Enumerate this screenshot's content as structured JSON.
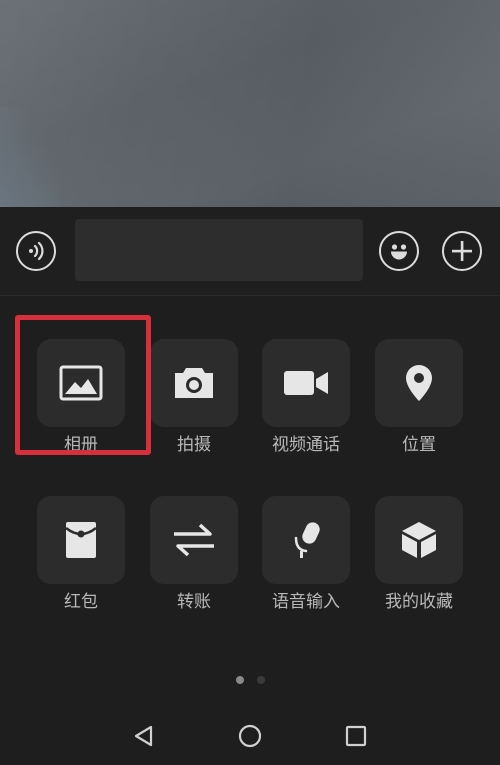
{
  "input_bar": {
    "voice_icon": "voice-wave-icon",
    "text_value": "",
    "emoji_icon": "smiley-icon",
    "plus_icon": "plus-icon"
  },
  "panel": {
    "items": [
      {
        "label": "相册",
        "icon": "image-icon"
      },
      {
        "label": "拍摄",
        "icon": "camera-icon"
      },
      {
        "label": "视频通话",
        "icon": "video-camera-icon"
      },
      {
        "label": "位置",
        "icon": "location-pin-icon"
      },
      {
        "label": "红包",
        "icon": "red-packet-icon"
      },
      {
        "label": "转账",
        "icon": "transfer-arrows-icon"
      },
      {
        "label": "语音输入",
        "icon": "microphone-icon"
      },
      {
        "label": "我的收藏",
        "icon": "cube-icon"
      }
    ],
    "page_count": 2,
    "current_page": 1,
    "highlight_color": "#d6303d"
  },
  "navbar": {
    "back_icon": "triangle-back-icon",
    "home_icon": "circle-home-icon",
    "recent_icon": "square-recent-icon"
  }
}
